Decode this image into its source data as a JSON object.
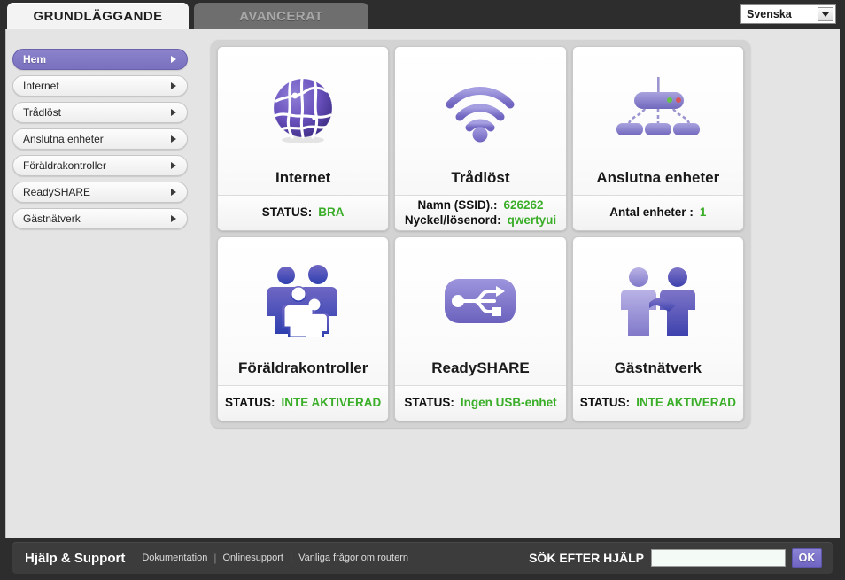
{
  "topbar": {
    "tabs": [
      {
        "label": "GRUNDLÄGGANDE",
        "active": true
      },
      {
        "label": "AVANCERAT",
        "active": false
      }
    ],
    "language": {
      "selected": "Svenska",
      "icon": "chevron-down-icon"
    }
  },
  "sidebar": {
    "items": [
      {
        "label": "Hem",
        "active": true
      },
      {
        "label": "Internet",
        "active": false
      },
      {
        "label": "Trådlöst",
        "active": false
      },
      {
        "label": "Anslutna enheter",
        "active": false
      },
      {
        "label": "Föräldrakontroller",
        "active": false
      },
      {
        "label": "ReadySHARE",
        "active": false
      },
      {
        "label": "Gästnätverk",
        "active": false
      }
    ]
  },
  "cards": [
    {
      "title": "Internet",
      "icon": "globe-icon",
      "lines": [
        {
          "label": "STATUS:",
          "value": "BRA"
        }
      ]
    },
    {
      "title": "Trådlöst",
      "icon": "wifi-icon",
      "lines": [
        {
          "label": "Namn (SSID).:",
          "value": "626262"
        },
        {
          "label": "Nyckel/lösenord:",
          "value": "qwertyui"
        }
      ]
    },
    {
      "title": "Anslutna enheter",
      "icon": "router-devices-icon",
      "lines": [
        {
          "label": "Antal enheter :",
          "value": "1"
        }
      ]
    },
    {
      "title": "Föräldrakontroller",
      "icon": "family-icon",
      "lines": [
        {
          "label": "STATUS:",
          "value": "INTE AKTIVERAD"
        }
      ]
    },
    {
      "title": "ReadySHARE",
      "icon": "usb-icon",
      "lines": [
        {
          "label": "STATUS:",
          "value": "Ingen USB-enhet"
        }
      ]
    },
    {
      "title": "Gästnätverk",
      "icon": "handshake-icon",
      "lines": [
        {
          "label": "STATUS:",
          "value": "INTE AKTIVERAD"
        }
      ]
    }
  ],
  "footer": {
    "title": "Hjälp & Support",
    "links": [
      "Dokumentation",
      "Onlinesupport",
      "Vanliga frågor om routern"
    ],
    "search_label": "SÖK EFTER HJÄLP",
    "search_value": "",
    "search_placeholder": "",
    "ok_label": "OK"
  },
  "colors": {
    "accent": "#7a71bf",
    "status_green": "#3aae28",
    "chrome_dark": "#2d2d2d",
    "panel_gray": "#d3d3d3"
  }
}
